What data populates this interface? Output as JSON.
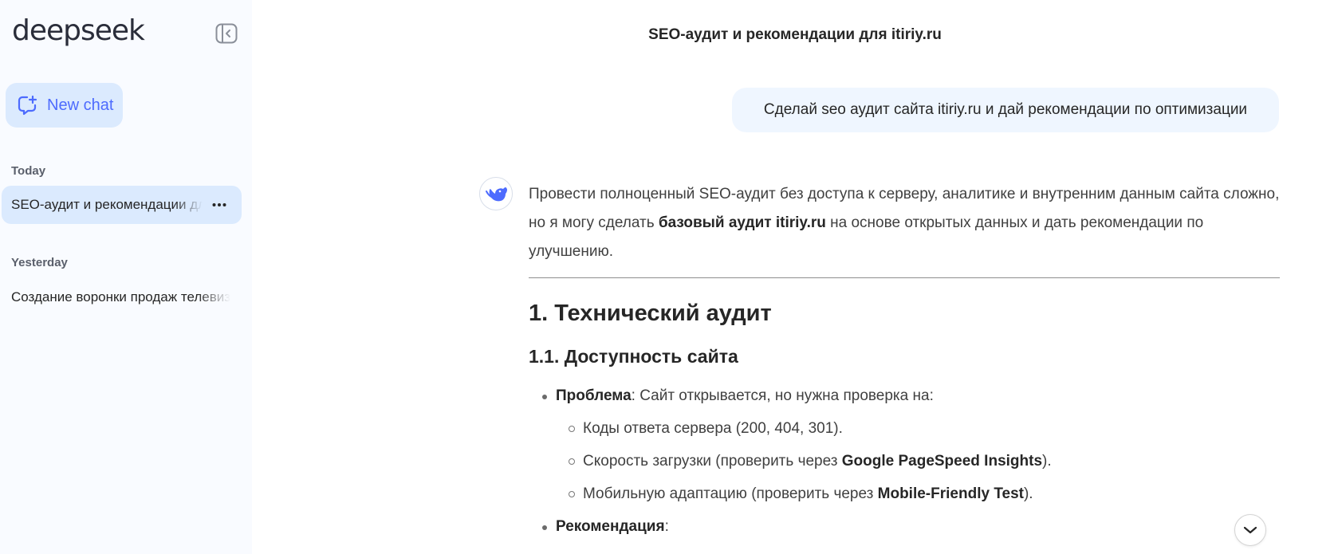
{
  "sidebar": {
    "logo": "deepseek",
    "new_chat_label": "New chat",
    "sections": {
      "today_label": "Today",
      "yesterday_label": "Yesterday"
    },
    "chats": {
      "active_title": "SEO-аудит и рекомендации для itiriy.ru",
      "yesterday_title": "Создание воронки продаж телевизоров"
    },
    "icons": {
      "collapse": "sidebar-collapse-icon",
      "new_chat": "chat-plus-icon",
      "more": "more-horizontal-icon"
    }
  },
  "header": {
    "title": "SEO-аудит и рекомендации для itiriy.ru"
  },
  "conversation": {
    "user_message": "Сделай seo аудит сайта itiriy.ru и дай рекомендации по оптимизации",
    "assistant": {
      "intro_1": "Провести полноценный SEO-аудит без доступа к серверу, аналитике и внутренним данным сайта сложно, но я могу сделать ",
      "intro_bold": "базовый аудит itiriy.ru",
      "intro_2": " на основе открытых данных и дать рекомендации по улучшению.",
      "h1": "1. Технический аудит",
      "h2": "1.1. Доступность сайта",
      "problem_label": "Проблема",
      "problem_text": ": Сайт открывается, но нужна проверка на:",
      "sub_1": "Коды ответа сервера (200, 404, 301).",
      "sub_2_pre": "Скорость загрузки (проверить через ",
      "sub_2_bold": "Google PageSpeed Insights",
      "sub_2_post": ").",
      "sub_3_pre": "Мобильную адаптацию (проверить через ",
      "sub_3_bold": "Mobile-Friendly Test",
      "sub_3_post": ").",
      "rec_label": "Рекомендация",
      "rec_colon": ":"
    }
  },
  "colors": {
    "accent": "#4d6bfe",
    "sidebar_bg": "#f9fbff",
    "active_bg": "#dbeafe",
    "user_bubble": "#eff6ff"
  }
}
